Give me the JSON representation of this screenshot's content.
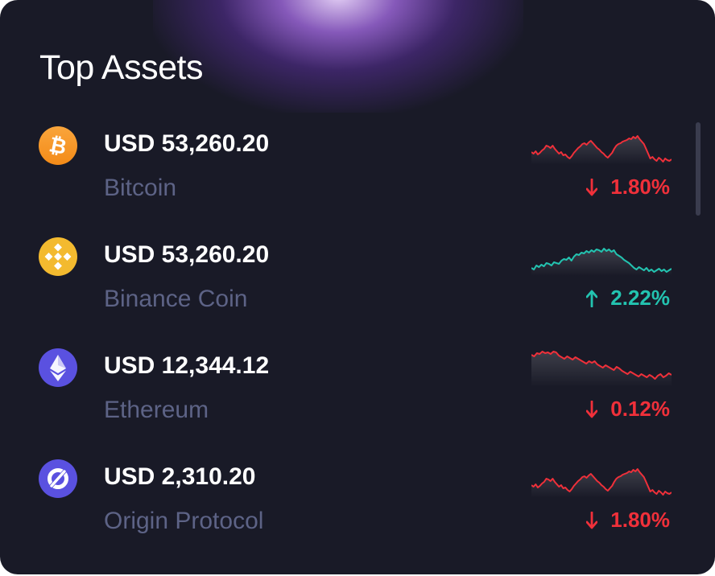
{
  "title": "Top Assets",
  "assets": [
    {
      "icon": "bitcoin-icon",
      "price": "USD 53,260.20",
      "name": "Bitcoin",
      "change": "1.80%",
      "direction": "down",
      "color": "#f0303a",
      "icon_color": "#f7931a",
      "sparkline": [
        38,
        40,
        37,
        41,
        39,
        36,
        34,
        30,
        31,
        33,
        30,
        34,
        37,
        40,
        38,
        42,
        41,
        44,
        46,
        43,
        39,
        36,
        33,
        31,
        28,
        27,
        29,
        26,
        24,
        27,
        30,
        33,
        35,
        38,
        40,
        43,
        45,
        42,
        39,
        34,
        30,
        28,
        27,
        25,
        24,
        23,
        21,
        22,
        19,
        21,
        18,
        22,
        25,
        28,
        34,
        40,
        46,
        44,
        47,
        49,
        45,
        47,
        50,
        46,
        48,
        49,
        47
      ]
    },
    {
      "icon": "binance-icon",
      "price": "USD 53,260.20",
      "name": "Binance Coin",
      "change": "2.22%",
      "direction": "up",
      "color": "#23c3b0",
      "icon_color": "#f3ba2f",
      "sparkline": [
        44,
        46,
        41,
        43,
        40,
        42,
        38,
        39,
        41,
        37,
        38,
        39,
        35,
        33,
        34,
        31,
        35,
        30,
        27,
        28,
        25,
        26,
        23,
        25,
        22,
        24,
        21,
        22,
        24,
        20,
        23,
        21,
        24,
        22,
        27,
        29,
        31,
        34,
        36,
        38,
        41,
        44,
        46,
        43,
        45,
        47,
        44,
        48,
        46,
        49,
        47,
        45,
        48,
        46,
        49,
        47,
        45
      ]
    },
    {
      "icon": "ethereum-icon",
      "price": "USD 12,344.12",
      "name": "Ethereum",
      "change": "0.12%",
      "direction": "down",
      "color": "#f0303a",
      "icon_color": "#5a51e0",
      "sparkline": [
        14,
        16,
        12,
        13,
        10,
        12,
        11,
        13,
        10,
        11,
        15,
        17,
        19,
        16,
        18,
        20,
        17,
        19,
        21,
        23,
        25,
        22,
        24,
        22,
        26,
        28,
        30,
        27,
        29,
        31,
        33,
        29,
        31,
        34,
        36,
        38,
        35,
        37,
        39,
        41,
        38,
        40,
        42,
        39,
        41,
        44,
        40,
        38,
        42,
        40,
        37,
        39
      ]
    },
    {
      "icon": "origin-protocol-icon",
      "price": "USD 2,310.20",
      "name": "Origin Protocol",
      "change": "1.80%",
      "direction": "down",
      "color": "#f0303a",
      "icon_color": "#5a51e0",
      "sparkline": [
        38,
        40,
        37,
        41,
        39,
        36,
        34,
        30,
        31,
        33,
        30,
        34,
        37,
        40,
        38,
        42,
        41,
        44,
        46,
        43,
        39,
        36,
        33,
        31,
        28,
        27,
        29,
        26,
        24,
        27,
        30,
        33,
        35,
        38,
        40,
        43,
        45,
        42,
        39,
        34,
        30,
        28,
        27,
        25,
        24,
        23,
        21,
        22,
        19,
        21,
        18,
        22,
        25,
        28,
        34,
        40,
        46,
        44,
        47,
        49,
        45,
        47,
        50,
        46,
        48,
        49,
        47
      ]
    }
  ]
}
